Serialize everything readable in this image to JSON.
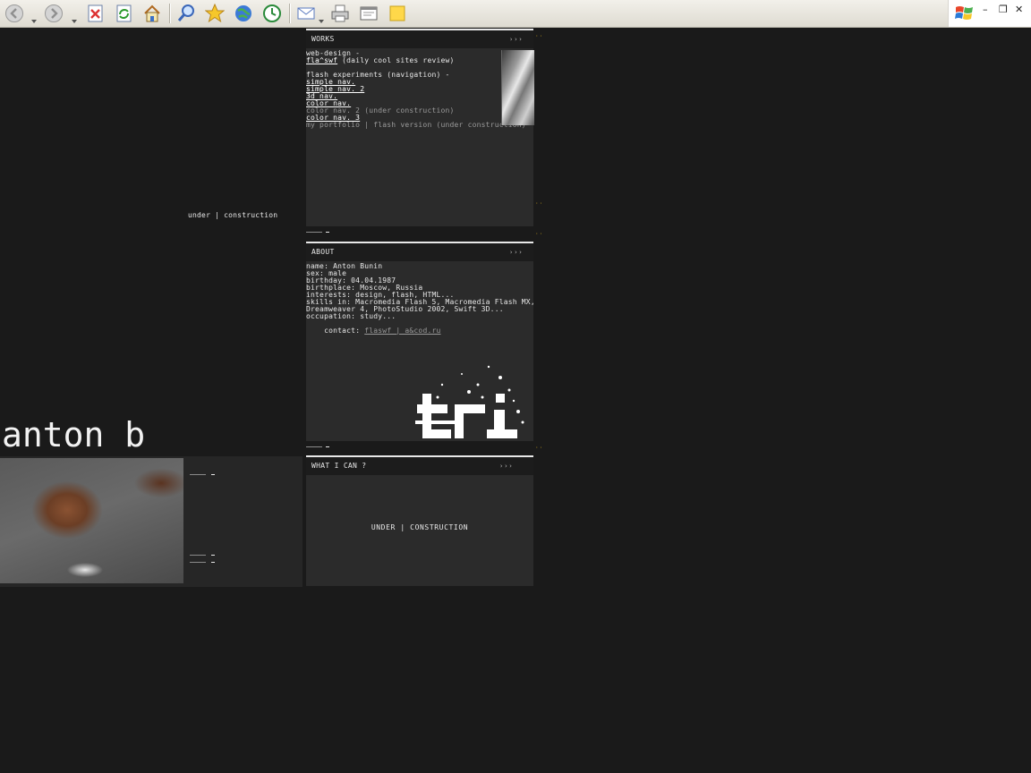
{
  "toolbar": {
    "icons": [
      "back-icon",
      "forward-icon",
      "stop-icon",
      "refresh-icon",
      "home-icon",
      "search-icon",
      "favorites-icon",
      "media-icon",
      "history-icon",
      "mail-icon",
      "print-icon",
      "edit-icon",
      "messenger-icon"
    ]
  },
  "window": {
    "minimize": "–",
    "restore": "❐",
    "close": "✕"
  },
  "site": {
    "name": "anton b",
    "under_construction_small": "under | construction"
  },
  "works": {
    "title": "WORKS",
    "arrows": "›››",
    "lines": [
      {
        "text": "web-design -",
        "style": "plain"
      },
      {
        "text": "fla^swf",
        "style": "link",
        "suffix": " (daily cool sites review)"
      },
      {
        "text": "",
        "style": "blank"
      },
      {
        "text": "flash experiments (navigation) -",
        "style": "plain"
      },
      {
        "text": "simple nav.",
        "style": "link"
      },
      {
        "text": "simple nav. 2",
        "style": "link"
      },
      {
        "text": "3d nav.",
        "style": "link"
      },
      {
        "text": "color nav.",
        "style": "link"
      },
      {
        "text": "color nav. 2 (under construction)",
        "style": "dim"
      },
      {
        "text": "color nav. 3",
        "style": "link"
      },
      {
        "text": "my portfolio | flash version (under construction)",
        "style": "dim"
      }
    ]
  },
  "about": {
    "title": "ABOUT",
    "arrows": "›››",
    "lines": [
      "name: Anton Bunin",
      "sex: male",
      "birthday: 04.04.1987",
      "birthplace: Moscow, Russia",
      "interests: design, flash, HTML...",
      "skills in: Macromedia Flash 5, Macromedia Flash MX,",
      "Dreamweaver 4, PhotoStudio 2002, Swift 3D..."
    ],
    "occupation": "occupation: study...",
    "contact_label": "contact: ",
    "contact_links": "flaswf | a&cod.ru"
  },
  "whatican": {
    "title": "WHAT I CAN ?",
    "arrows": "›››",
    "body": "UNDER | CONSTRUCTION"
  },
  "colors": {
    "bg": "#1a1a1a",
    "panel": "#2b2b2b",
    "text": "#e8e8e8",
    "accent": "#c9a21a"
  }
}
